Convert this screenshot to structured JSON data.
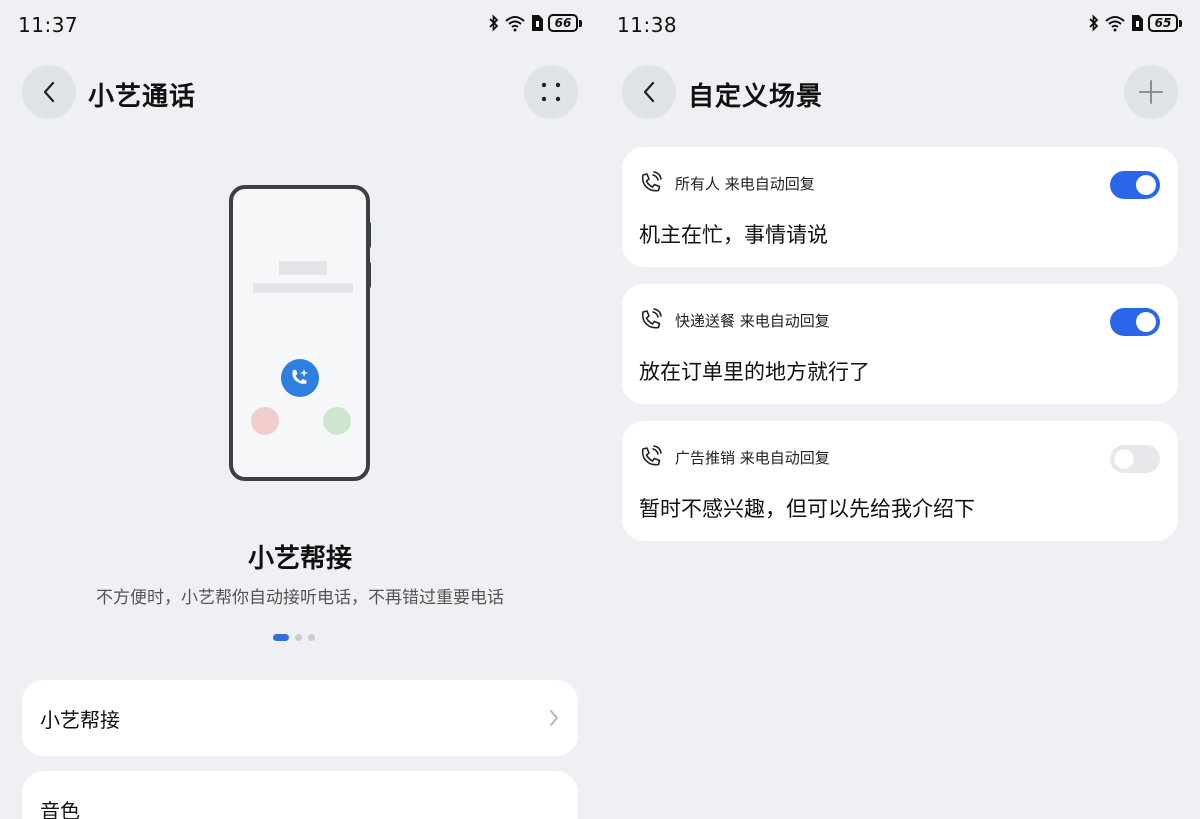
{
  "left": {
    "status": {
      "time": "11:37",
      "battery": "66"
    },
    "title": "小艺通话",
    "feature": {
      "title": "小艺帮接",
      "description": "不方便时，小艺帮你自动接听电话，不再错过重要电话"
    },
    "carousel": {
      "current": 1,
      "total": 3
    },
    "list": [
      {
        "label": "小艺帮接"
      },
      {
        "label": "音色"
      }
    ]
  },
  "right": {
    "status": {
      "time": "11:38",
      "battery": "65"
    },
    "title": "自定义场景",
    "scenes": [
      {
        "label": "所有人 来电自动回复",
        "reply": "机主在忙，事情请说",
        "enabled": true
      },
      {
        "label": "快递送餐 来电自动回复",
        "reply": "放在订单里的地方就行了",
        "enabled": true
      },
      {
        "label": "广告推销 来电自动回复",
        "reply": "暂时不感兴趣，但可以先给我介绍下",
        "enabled": false
      }
    ]
  },
  "colors": {
    "accent": "#2a67e8",
    "background": "#eef0f3",
    "card": "#ffffff"
  },
  "icons": [
    "back-icon",
    "more-dots-icon",
    "plus-icon",
    "call-wave-icon",
    "chevron-right-icon",
    "bluetooth-icon",
    "wifi-icon",
    "sim-icon"
  ]
}
